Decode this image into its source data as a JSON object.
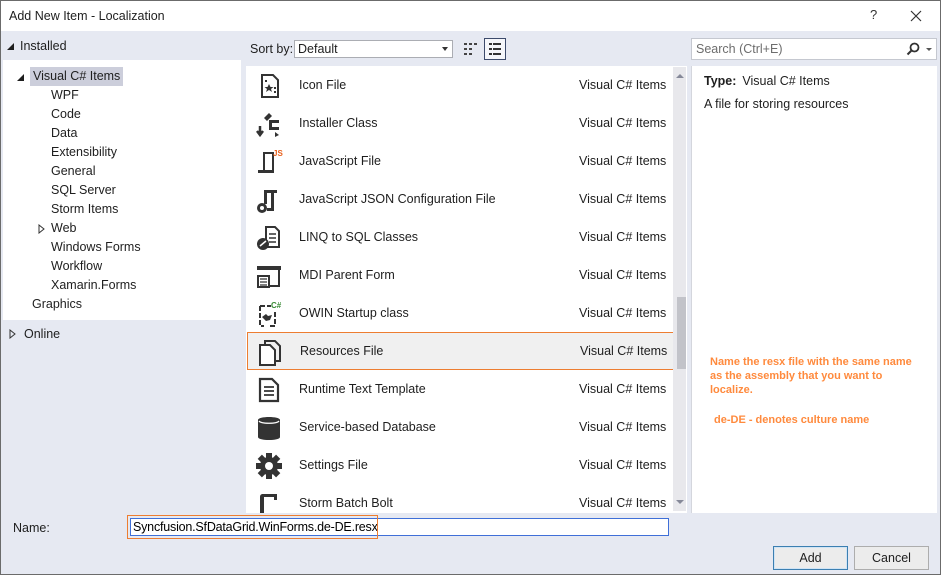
{
  "window": {
    "title": "Add New Item - Localization",
    "help_label": "?",
    "close_icon": "close-icon"
  },
  "left_pane": {
    "installed_label": "Installed",
    "tree": [
      {
        "label": "Visual C# Items",
        "level": 1,
        "expanded": true,
        "selected": true
      },
      {
        "label": "WPF",
        "level": 2
      },
      {
        "label": "Code",
        "level": 2
      },
      {
        "label": "Data",
        "level": 2
      },
      {
        "label": "Extensibility",
        "level": 2
      },
      {
        "label": "General",
        "level": 2
      },
      {
        "label": "SQL Server",
        "level": 2
      },
      {
        "label": "Storm Items",
        "level": 2
      },
      {
        "label": "Web",
        "level": 2,
        "collapsed": true
      },
      {
        "label": "Windows Forms",
        "level": 2
      },
      {
        "label": "Workflow",
        "level": 2
      },
      {
        "label": "Xamarin.Forms",
        "level": 2
      },
      {
        "label": "Graphics",
        "level": 1
      }
    ],
    "online_label": "Online"
  },
  "toolbar": {
    "sort_label": "Sort by:",
    "sort_value": "Default",
    "view_small_icons": "small-icons-view-icon",
    "view_list": "list-view-icon"
  },
  "items": [
    {
      "name": "Icon File",
      "category": "Visual C# Items",
      "icon": "icon-file-icon"
    },
    {
      "name": "Installer Class",
      "category": "Visual C# Items",
      "icon": "installer-icon"
    },
    {
      "name": "JavaScript File",
      "category": "Visual C# Items",
      "icon": "javascript-file-icon",
      "badge": "JS"
    },
    {
      "name": "JavaScript JSON Configuration File",
      "category": "Visual C# Items",
      "icon": "json-config-icon"
    },
    {
      "name": "LINQ to SQL Classes",
      "category": "Visual C# Items",
      "icon": "linq-icon"
    },
    {
      "name": "MDI Parent Form",
      "category": "Visual C# Items",
      "icon": "mdi-form-icon"
    },
    {
      "name": "OWIN Startup class",
      "category": "Visual C# Items",
      "icon": "owin-icon",
      "badge": "C#"
    },
    {
      "name": "Resources File",
      "category": "Visual C# Items",
      "icon": "resources-file-icon",
      "selected": true
    },
    {
      "name": "Runtime Text Template",
      "category": "Visual C# Items",
      "icon": "text-template-icon"
    },
    {
      "name": "Service-based Database",
      "category": "Visual C# Items",
      "icon": "database-icon"
    },
    {
      "name": "Settings File",
      "category": "Visual C# Items",
      "icon": "settings-gear-icon"
    },
    {
      "name": "Storm Batch Bolt",
      "category": "Visual C# Items",
      "icon": "storm-bolt-icon"
    }
  ],
  "search": {
    "placeholder": "Search (Ctrl+E)"
  },
  "details": {
    "type_label": "Type:",
    "type_value": "Visual C# Items",
    "description": "A file for storing resources",
    "annotation_line1": "Name the resx file with the same name as the assembly that you want to localize.",
    "annotation_line2": "de-DE - denotes culture name"
  },
  "bottom": {
    "name_label": "Name:",
    "name_value": "Syncfusion.SfDataGrid.WinForms.de-DE.resx",
    "add_label": "Add",
    "cancel_label": "Cancel"
  },
  "colors": {
    "accent_orange": "#ed7d31",
    "annotation_text": "#ff8a3d",
    "focus_blue": "#3f6fd8",
    "js_badge": "#e8601c",
    "cs_badge": "#388a34"
  }
}
